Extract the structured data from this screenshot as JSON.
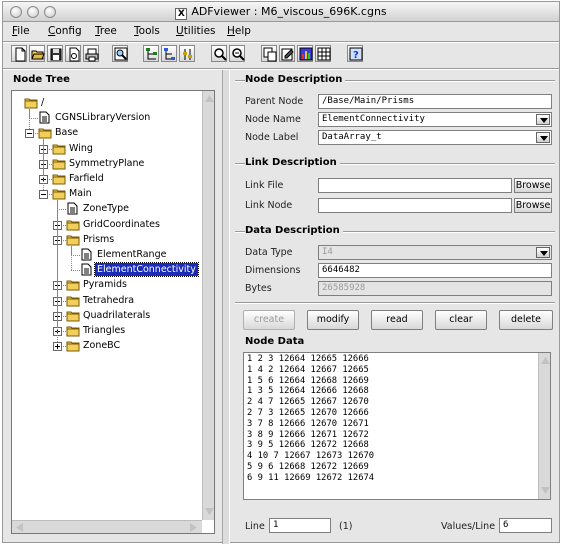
{
  "window": {
    "title": "ADFviewer : M6_viscous_696K.cgns"
  },
  "menu": [
    {
      "label": "File",
      "u": "F",
      "rest": "ile"
    },
    {
      "label": "Config",
      "u": "C",
      "rest": "onfig"
    },
    {
      "label": "Tree",
      "u": "T",
      "rest": "ree"
    },
    {
      "label": "Tools",
      "u": "T",
      "rest": "ools"
    },
    {
      "label": "Utilities",
      "u": "U",
      "rest": "tilities"
    },
    {
      "label": "Help",
      "u": "H",
      "rest": "elp"
    }
  ],
  "toolbar_icons": [
    "new-file-icon",
    "open-folder-icon",
    "save-icon",
    "save-as-icon",
    "print-icon",
    "find-node-icon",
    "collapse-tree-icon",
    "expand-tree-icon",
    "level-icon",
    "zoom-in-icon",
    "zoom-out-icon",
    "copy-node-icon",
    "edit-node-icon",
    "plot-icon",
    "grid-icon",
    "help-icon"
  ],
  "left": {
    "title": "Node Tree",
    "tree": [
      {
        "label": "/",
        "depth": 0,
        "toggle": "",
        "icon": "folder"
      },
      {
        "label": "CGNSLibraryVersion",
        "depth": 1,
        "toggle": "",
        "icon": "doc"
      },
      {
        "label": "Base",
        "depth": 1,
        "toggle": "minus",
        "icon": "folder"
      },
      {
        "label": "Wing",
        "depth": 2,
        "toggle": "plus",
        "icon": "folder"
      },
      {
        "label": "SymmetryPlane",
        "depth": 2,
        "toggle": "plus",
        "icon": "folder"
      },
      {
        "label": "Farfield",
        "depth": 2,
        "toggle": "plus",
        "icon": "folder"
      },
      {
        "label": "Main",
        "depth": 2,
        "toggle": "minus",
        "icon": "folder"
      },
      {
        "label": "ZoneType",
        "depth": 3,
        "toggle": "",
        "icon": "doc"
      },
      {
        "label": "GridCoordinates",
        "depth": 3,
        "toggle": "plus",
        "icon": "folder"
      },
      {
        "label": "Prisms",
        "depth": 3,
        "toggle": "minus",
        "icon": "folder"
      },
      {
        "label": "ElementRange",
        "depth": 4,
        "toggle": "",
        "icon": "doc"
      },
      {
        "label": "ElementConnectivity",
        "depth": 4,
        "toggle": "",
        "icon": "doc",
        "selected": true
      },
      {
        "label": "Pyramids",
        "depth": 3,
        "toggle": "plus",
        "icon": "folder"
      },
      {
        "label": "Tetrahedra",
        "depth": 3,
        "toggle": "plus",
        "icon": "folder"
      },
      {
        "label": "Quadrilaterals",
        "depth": 3,
        "toggle": "plus",
        "icon": "folder"
      },
      {
        "label": "Triangles",
        "depth": 3,
        "toggle": "plus",
        "icon": "folder"
      },
      {
        "label": "ZoneBC",
        "depth": 3,
        "toggle": "plus",
        "icon": "folder"
      }
    ]
  },
  "node_description": {
    "title": "Node Description",
    "parent_node_label": "Parent Node",
    "parent_node": "/Base/Main/Prisms",
    "node_name_label": "Node Name",
    "node_name": "ElementConnectivity",
    "node_label_label": "Node Label",
    "node_label": "DataArray_t"
  },
  "link_description": {
    "title": "Link Description",
    "link_file_label": "Link File",
    "link_file": "",
    "link_node_label": "Link Node",
    "link_node": "",
    "browse": "Browse"
  },
  "data_description": {
    "title": "Data Description",
    "data_type_label": "Data Type",
    "data_type": "I4",
    "dimensions_label": "Dimensions",
    "dimensions": "6646482",
    "bytes_label": "Bytes",
    "bytes": "26585928"
  },
  "actions": {
    "create": "create",
    "modify": "modify",
    "read": "read",
    "clear": "clear",
    "delete": "delete"
  },
  "node_data": {
    "title": "Node Data",
    "lines": [
      "1 2 3 12664 12665 12666",
      "1 4 2 12664 12667 12665",
      "1 5 6 12664 12668 12669",
      "1 3 5 12664 12666 12668",
      "2 4 7 12665 12667 12670",
      "2 7 3 12665 12670 12666",
      "3 7 8 12666 12670 12671",
      "3 8 9 12666 12671 12672",
      "3 9 5 12666 12672 12668",
      "4 10 7 12667 12673 12670",
      "5 9 6 12668 12672 12669",
      "6 9 11 12669 12672 12674"
    ],
    "line_label": "Line",
    "line_value": "1",
    "line_count": "(1)",
    "values_per_line_label": "Values/Line",
    "values_per_line": "6"
  }
}
